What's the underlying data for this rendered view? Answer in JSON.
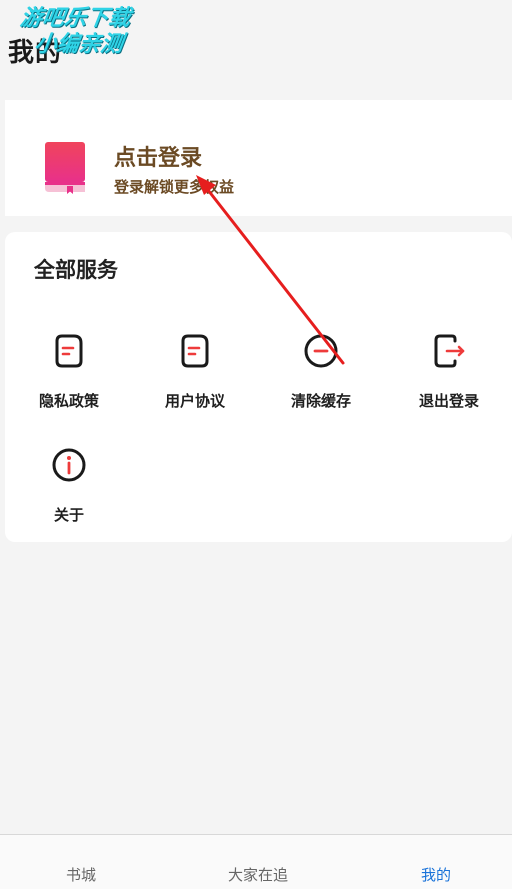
{
  "header": {
    "title": "我的"
  },
  "watermark": {
    "line1": "游吧乐下载",
    "line2": "小编亲测"
  },
  "login": {
    "title": "点击登录",
    "subtitle": "登录解锁更多权益",
    "book_icon": "book-icon",
    "book_color": "#f2456a"
  },
  "services": {
    "title": "全部服务",
    "items": [
      {
        "label": "隐私政策",
        "icon": "document-icon"
      },
      {
        "label": "用户协议",
        "icon": "document-icon"
      },
      {
        "label": "清除缓存",
        "icon": "minus-circle-icon"
      },
      {
        "label": "退出登录",
        "icon": "logout-icon"
      },
      {
        "label": "关于",
        "icon": "info-icon"
      }
    ]
  },
  "tabbar": {
    "tabs": [
      {
        "label": "书城"
      },
      {
        "label": "大家在追"
      },
      {
        "label": "我的",
        "active": true
      }
    ],
    "active_color": "#1a73d9"
  },
  "colors": {
    "icon_accent": "#ee3b3b",
    "brown_text": "#6b4a24"
  }
}
